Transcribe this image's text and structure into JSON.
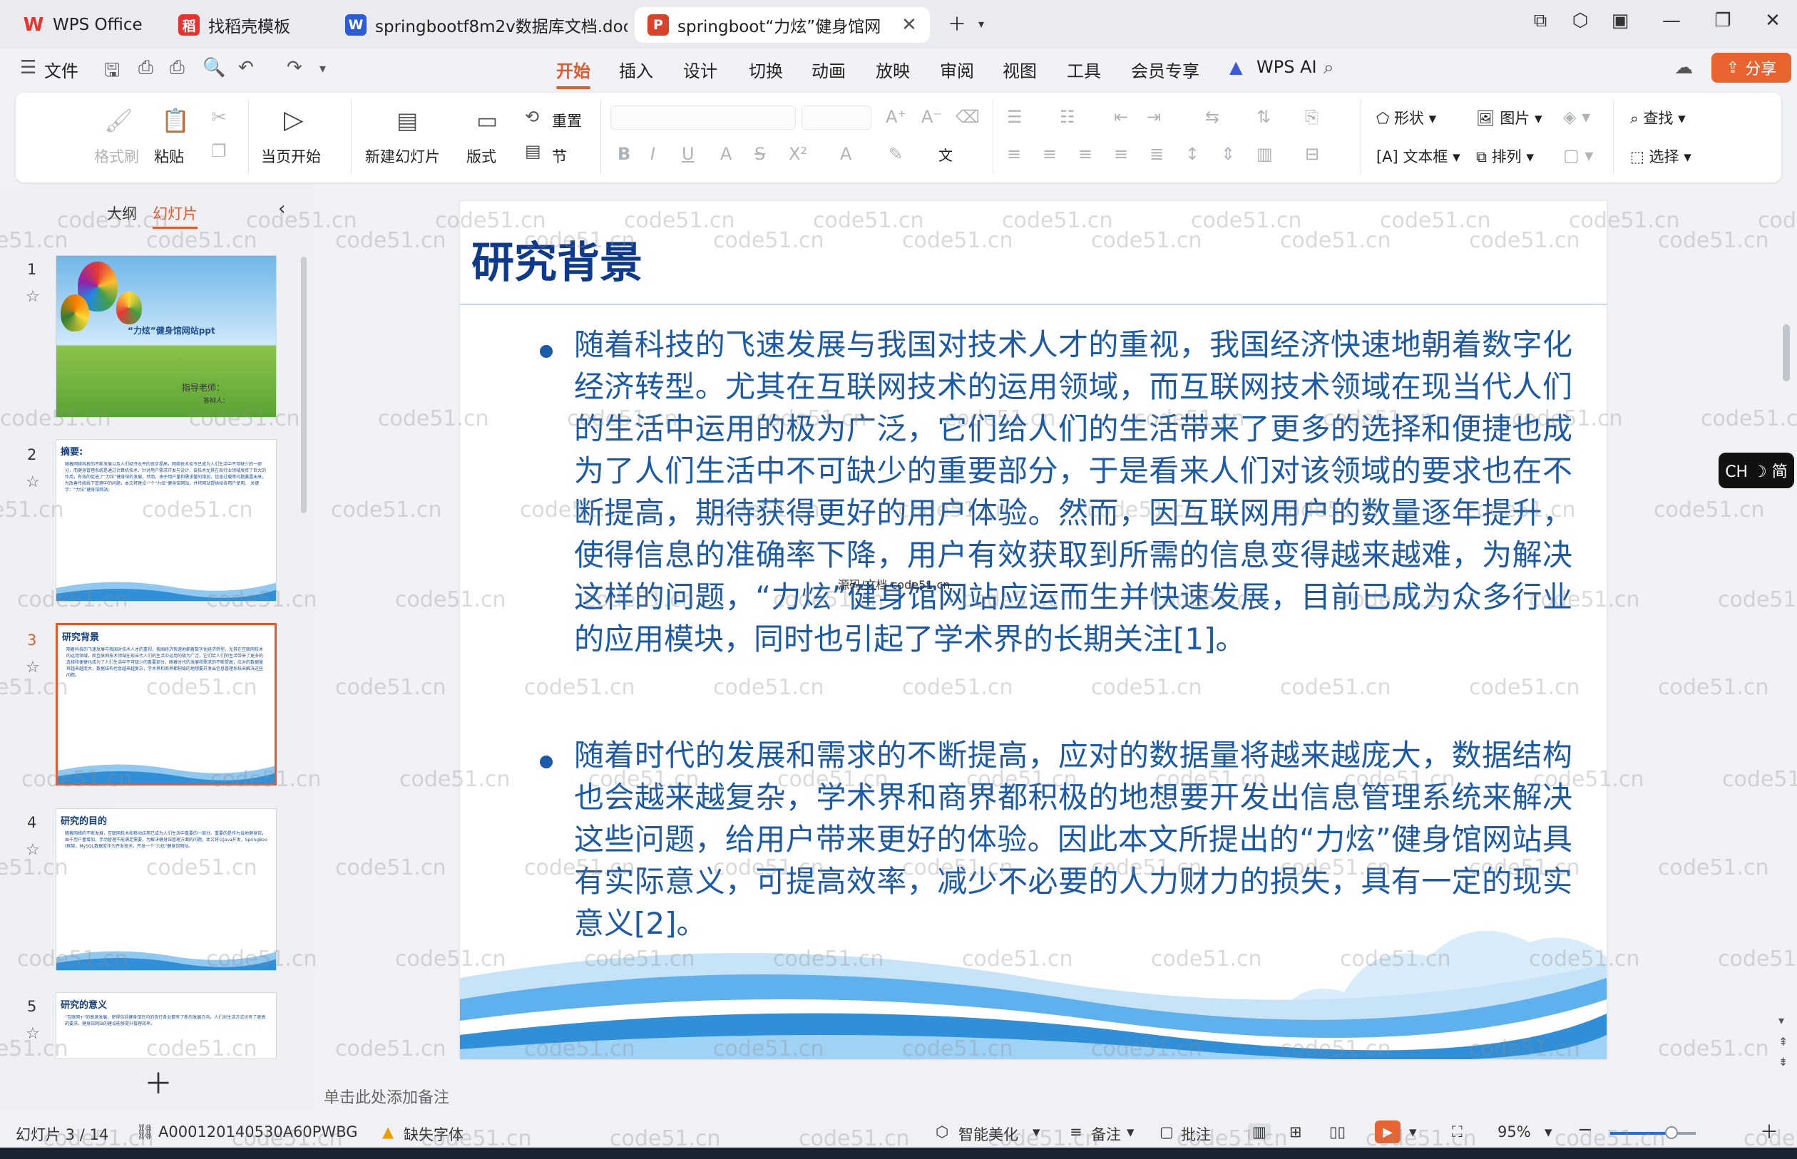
{
  "tabs": [
    {
      "label": "WPS Office",
      "icon": "wps-logo-icon",
      "color": "#e8322d"
    },
    {
      "label": "找稻壳模板",
      "icon": "docer-icon",
      "color": "#e8322d"
    },
    {
      "label": "springbootf8m2v数据库文档.doc",
      "icon": "word-doc-icon",
      "color": "#2b5bd7"
    },
    {
      "label": "springboot“力炫”健身馆网",
      "icon": "ppt-icon",
      "color": "#d9432a"
    }
  ],
  "menu": {
    "file": "文件",
    "items": [
      "开始",
      "插入",
      "设计",
      "切换",
      "动画",
      "放映",
      "审阅",
      "视图",
      "工具",
      "会员专享"
    ],
    "active": "开始",
    "wps_ai": "WPS AI",
    "share": "分享"
  },
  "ribbon": {
    "format_painter": "格式刷",
    "paste": "粘贴",
    "play_from_current": "当页开始",
    "new_slide": "新建幻灯片",
    "layout": "版式",
    "reset": "重置",
    "section": "节",
    "shape": "形状",
    "picture": "图片",
    "textbox": "文本框",
    "arrange": "排列",
    "find": "查找",
    "select": "选择"
  },
  "left_panel": {
    "tab_outline": "大纲",
    "tab_slides": "幻灯片",
    "thumbnails": [
      {
        "num": "1",
        "title": "“力炫”健身馆网站ppt",
        "sub": "指导老师：",
        "sub2": "答辩人："
      },
      {
        "num": "2",
        "title": "摘要:",
        "body": "随着网络科技的不断发展以及人们经济水平的逐步提高，网络技术如今已成为人们生活中不可缺少的一部分，而健身管理系统是通过计算机技术，针对用户需求开发与设计，该技术尤其在各行业领域发挥了巨大的作用，有效的促进了“力炫”健身馆的发展。然而，由于用户量和需求量的增加，信息过载等问题暴露出来，为改善传统线下管理中的问题，本文将建设一个“力炫”健身馆网站，并将网站提供给各用户使用。 关键字：“力炫”健身馆网站;"
      },
      {
        "num": "3",
        "title": "研究背景",
        "body": "随着科技的飞速发展与我国对技术人才的重视，我国经济快速地朝着数字化经济转型。尤其在互联网技术的运用领域，而互联网技术领域在现当代人们的生活中运用的极为广泛，它们给人们的生活带来了更多的选择和便捷也成为了人们生活中不可缺少的重要部分。随着时代的发展和需求的不断提高，应对的数据量将越来越庞大，数据结构也会越来越复杂，学术界和商界都积极的地想要开发出信息管理系统来解决这些问题。"
      },
      {
        "num": "4",
        "title": "研究的目的",
        "body": "随着网络的不断发展，互联网技术和移动应用已成为人们生活中重要的一部分。重要的是作为当地健身馆，由于用户量增加，手动管理不能满足需要，为解决健身馆管理方面的问题，本文将以Java开发，SpringBoot框架，MySQL数据库作为开发技术，开发一个“力炫”健身馆网站。"
      },
      {
        "num": "5",
        "title": "研究的意义",
        "body": "“互联网+”的高速发展，使得包括健身馆在内的各行各业都有了新的发展方向，人们对生活方式也有了更高的要求。健身馆网站的建设能够提升管理效率。"
      }
    ],
    "add_slide_icon": "plus-icon"
  },
  "slide": {
    "title": "研究背景",
    "paragraphs": [
      "随着科技的飞速发展与我国对技术人才的重视，我国经济快速地朝着数字化经济转型。尤其在互联网技术的运用领域，而互联网技术领域在现当代人们的生活中运用的极为广泛，它们给人们的生活带来了更多的选择和便捷也成为了人们生活中不可缺少的重要部分，于是看来人们对该领域的要求也在不断提高，期待获得更好的用户体验。然而，因互联网用户的数量逐年提升，使得信息的准确率下降，用户有效获取到所需的信息变得越来越难，为解决这样的问题，“力炫”健身馆网站应运而生并快速发展，目前已成为众多行业的应用模块，同时也引起了学术界的长期关注[1]。",
      "随着时代的发展和需求的不断提高，应对的数据量将越来越庞大，数据结构也会越来越复杂，学术界和商界都积极的地想要开发出信息管理系统来解决这些问题，给用户带来更好的体验。因此本文所提出的“力炫”健身馆网站具有实际意义，可提高效率，减少不必要的人力财力的损失，具有一定的现实意义[2]。"
    ],
    "inner_watermark": "源码/文档 code51.cn"
  },
  "notes_placeholder": "单击此处添加备注",
  "status": {
    "slide_counter": "幻灯片 3 / 14",
    "doc_id": "A000120140530A60PWBG",
    "missing_fonts": "缺失字体",
    "smart_beautify": "智能美化",
    "notes": "备注",
    "comments": "批注",
    "zoom": "95%",
    "zoom_fraction": 0.72
  },
  "ime": "CH ☽ 简",
  "watermark_text": "code51.cn"
}
